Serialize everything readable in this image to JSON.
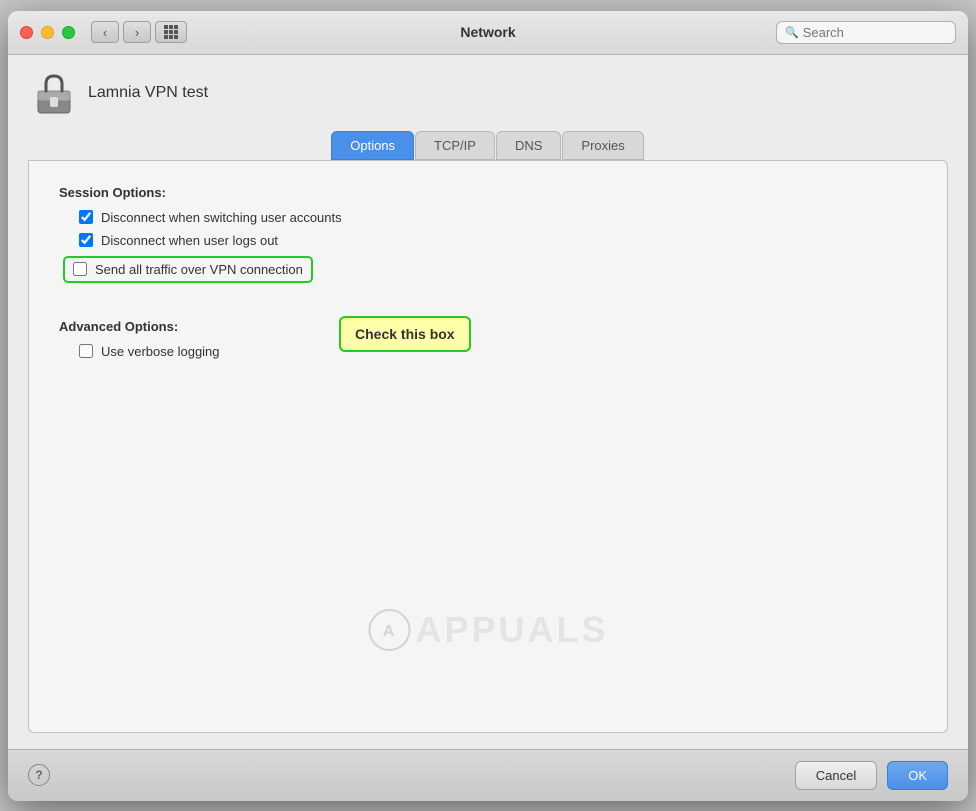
{
  "titlebar": {
    "title": "Network",
    "search_placeholder": "Search"
  },
  "vpn": {
    "name": "Lamnia VPN test"
  },
  "tabs": [
    {
      "id": "options",
      "label": "Options",
      "active": true
    },
    {
      "id": "tcpip",
      "label": "TCP/IP",
      "active": false
    },
    {
      "id": "dns",
      "label": "DNS",
      "active": false
    },
    {
      "id": "proxies",
      "label": "Proxies",
      "active": false
    }
  ],
  "session_options": {
    "label": "Session Options:",
    "items": [
      {
        "id": "disconnect-user",
        "label": "Disconnect when switching user accounts",
        "checked": true
      },
      {
        "id": "disconnect-logout",
        "label": "Disconnect when user logs out",
        "checked": true
      },
      {
        "id": "send-traffic",
        "label": "Send all traffic over VPN connection",
        "checked": false,
        "highlighted": true
      }
    ]
  },
  "advanced_options": {
    "label": "Advanced Options:",
    "items": [
      {
        "id": "verbose-logging",
        "label": "Use verbose logging",
        "checked": false
      }
    ]
  },
  "tooltip": {
    "text": "Check this box"
  },
  "watermark": {
    "text": "APPUALS"
  },
  "bottom": {
    "help_label": "?",
    "cancel_label": "Cancel",
    "ok_label": "OK"
  }
}
